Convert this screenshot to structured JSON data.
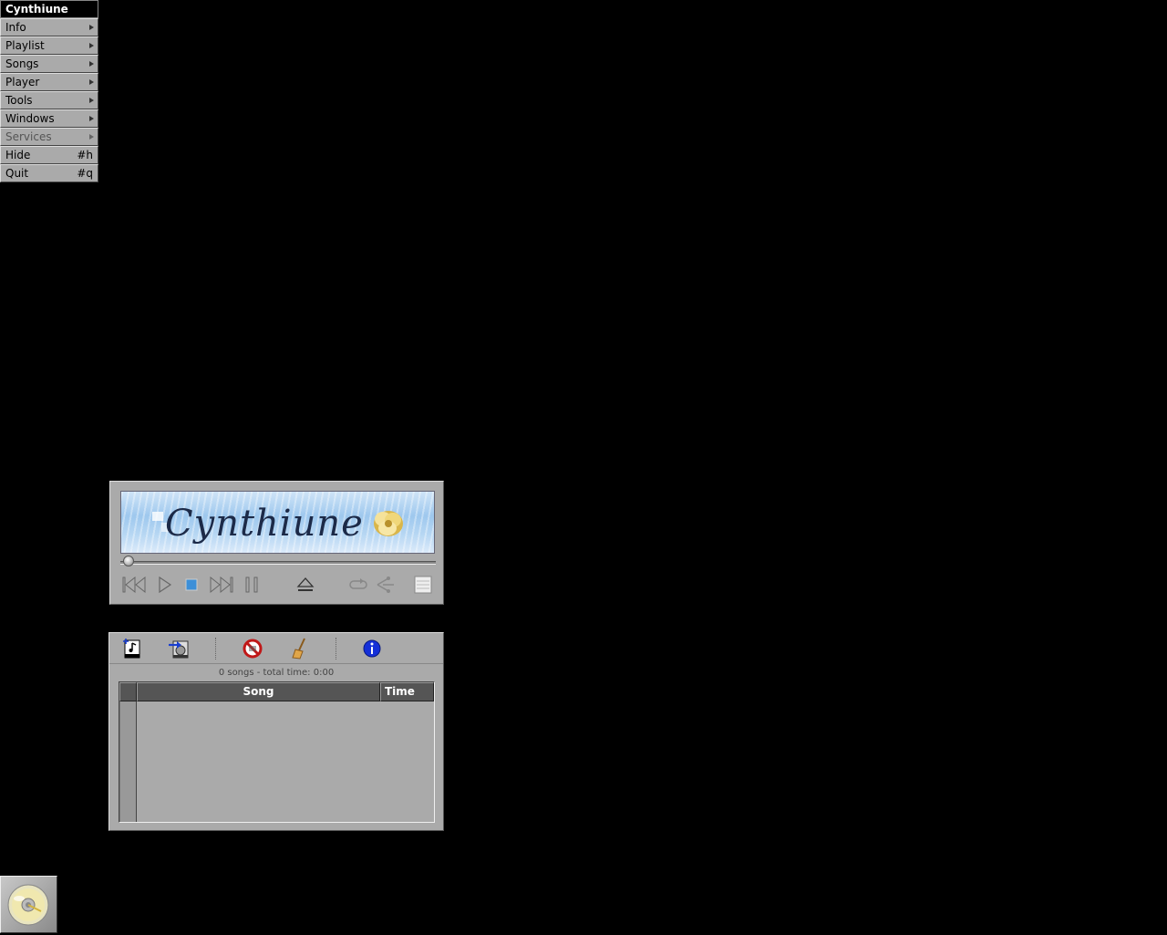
{
  "menu": {
    "title": "Cynthiune",
    "items": [
      {
        "label": "Info",
        "submenu": true
      },
      {
        "label": "Playlist",
        "submenu": true
      },
      {
        "label": "Songs",
        "submenu": true
      },
      {
        "label": "Player",
        "submenu": true
      },
      {
        "label": "Tools",
        "submenu": true
      },
      {
        "label": "Windows",
        "submenu": true
      },
      {
        "label": "Services",
        "submenu": true,
        "disabled": true
      },
      {
        "label": "Hide",
        "shortcut": "#h"
      },
      {
        "label": "Quit",
        "shortcut": "#q"
      }
    ]
  },
  "player": {
    "display_title": "Cynthiune",
    "seek_position": 0,
    "controls": [
      "previous-icon",
      "play-icon",
      "stop-icon",
      "next-icon",
      "pause-icon",
      "eject-icon",
      "repeat-icon",
      "shuffle-icon",
      "playlist-toggle-icon"
    ]
  },
  "playlist": {
    "toolbar": [
      "add-song-icon",
      "add-folder-icon",
      "remove-icon",
      "clear-icon",
      "info-icon"
    ],
    "status": "0 songs - total time: 0:00",
    "columns": {
      "song": "Song",
      "time": "Time"
    },
    "rows": []
  },
  "colors": {
    "desktop": "#000000",
    "panel": "#aaaaaa",
    "header": "#555555",
    "display_blue": "#9ec8ee"
  }
}
